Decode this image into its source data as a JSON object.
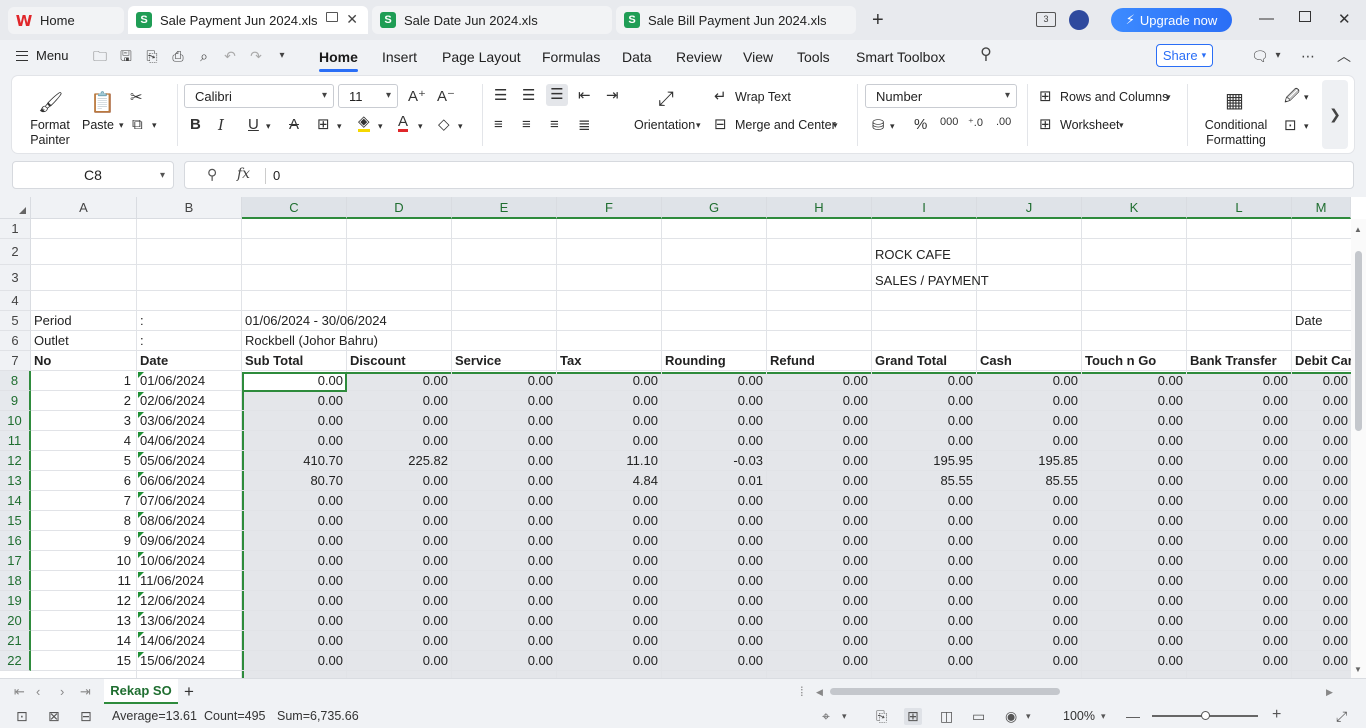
{
  "titlebar": {
    "home_tab": "Home",
    "tabs": [
      {
        "label": "Sale Payment Jun 2024.xls",
        "active": true
      },
      {
        "label": "Sale Date Jun 2024.xls",
        "active": false
      },
      {
        "label": "Sale Bill Payment Jun 2024.xls",
        "active": false
      }
    ],
    "panel_badge": "3",
    "upgrade": "Upgrade now"
  },
  "menubar": {
    "menu": "Menu",
    "tabs": [
      "Home",
      "Insert",
      "Page Layout",
      "Formulas",
      "Data",
      "Review",
      "View",
      "Tools",
      "Smart Toolbox"
    ],
    "share": "Share"
  },
  "ribbon": {
    "format_painter": "Format Painter",
    "paste": "Paste",
    "font_name": "Calibri",
    "font_size": "11",
    "wrap_text": "Wrap Text",
    "orientation": "Orientation",
    "merge_center": "Merge and Center",
    "number_format": "Number",
    "rows_columns": "Rows and Columns",
    "worksheet": "Worksheet",
    "conditional_formatting": "Conditional Formatting"
  },
  "formula_bar": {
    "name_box": "C8",
    "fx": "fx",
    "value": "0"
  },
  "columns": [
    "A",
    "B",
    "C",
    "D",
    "E",
    "F",
    "G",
    "H",
    "I",
    "J",
    "K",
    "L",
    "M"
  ],
  "row_numbers": [
    "1",
    "2",
    "3",
    "4",
    "5",
    "6",
    "7",
    "8",
    "9",
    "10",
    "11",
    "12",
    "13",
    "14",
    "15",
    "16",
    "17",
    "18",
    "19",
    "20",
    "21",
    "22"
  ],
  "sheet_text": {
    "company": "ROCK CAFE",
    "report": "SALES / PAYMENT",
    "period_label": "Period",
    "period_colon": ":",
    "period_value": "01/06/2024 - 30/06/2024",
    "date_label": "Date",
    "outlet_label": "Outlet",
    "outlet_colon": ":",
    "outlet_value": "Rockbell (Johor Bahru)"
  },
  "table_headers": [
    "No",
    "Date",
    "Sub Total",
    "Discount",
    "Service",
    "Tax",
    "Rounding",
    "Refund",
    "Grand Total",
    "Cash",
    "Touch n Go",
    "Bank Transfer",
    "Debit Car"
  ],
  "table_rows": [
    [
      "1",
      "01/06/2024",
      "0.00",
      "0.00",
      "0.00",
      "0.00",
      "0.00",
      "0.00",
      "0.00",
      "0.00",
      "0.00",
      "0.00",
      "0.00"
    ],
    [
      "2",
      "02/06/2024",
      "0.00",
      "0.00",
      "0.00",
      "0.00",
      "0.00",
      "0.00",
      "0.00",
      "0.00",
      "0.00",
      "0.00",
      "0.00"
    ],
    [
      "3",
      "03/06/2024",
      "0.00",
      "0.00",
      "0.00",
      "0.00",
      "0.00",
      "0.00",
      "0.00",
      "0.00",
      "0.00",
      "0.00",
      "0.00"
    ],
    [
      "4",
      "04/06/2024",
      "0.00",
      "0.00",
      "0.00",
      "0.00",
      "0.00",
      "0.00",
      "0.00",
      "0.00",
      "0.00",
      "0.00",
      "0.00"
    ],
    [
      "5",
      "05/06/2024",
      "410.70",
      "225.82",
      "0.00",
      "11.10",
      "-0.03",
      "0.00",
      "195.95",
      "195.85",
      "0.00",
      "0.00",
      "0.00"
    ],
    [
      "6",
      "06/06/2024",
      "80.70",
      "0.00",
      "0.00",
      "4.84",
      "0.01",
      "0.00",
      "85.55",
      "85.55",
      "0.00",
      "0.00",
      "0.00"
    ],
    [
      "7",
      "07/06/2024",
      "0.00",
      "0.00",
      "0.00",
      "0.00",
      "0.00",
      "0.00",
      "0.00",
      "0.00",
      "0.00",
      "0.00",
      "0.00"
    ],
    [
      "8",
      "08/06/2024",
      "0.00",
      "0.00",
      "0.00",
      "0.00",
      "0.00",
      "0.00",
      "0.00",
      "0.00",
      "0.00",
      "0.00",
      "0.00"
    ],
    [
      "9",
      "09/06/2024",
      "0.00",
      "0.00",
      "0.00",
      "0.00",
      "0.00",
      "0.00",
      "0.00",
      "0.00",
      "0.00",
      "0.00",
      "0.00"
    ],
    [
      "10",
      "10/06/2024",
      "0.00",
      "0.00",
      "0.00",
      "0.00",
      "0.00",
      "0.00",
      "0.00",
      "0.00",
      "0.00",
      "0.00",
      "0.00"
    ],
    [
      "11",
      "11/06/2024",
      "0.00",
      "0.00",
      "0.00",
      "0.00",
      "0.00",
      "0.00",
      "0.00",
      "0.00",
      "0.00",
      "0.00",
      "0.00"
    ],
    [
      "12",
      "12/06/2024",
      "0.00",
      "0.00",
      "0.00",
      "0.00",
      "0.00",
      "0.00",
      "0.00",
      "0.00",
      "0.00",
      "0.00",
      "0.00"
    ],
    [
      "13",
      "13/06/2024",
      "0.00",
      "0.00",
      "0.00",
      "0.00",
      "0.00",
      "0.00",
      "0.00",
      "0.00",
      "0.00",
      "0.00",
      "0.00"
    ],
    [
      "14",
      "14/06/2024",
      "0.00",
      "0.00",
      "0.00",
      "0.00",
      "0.00",
      "0.00",
      "0.00",
      "0.00",
      "0.00",
      "0.00",
      "0.00"
    ],
    [
      "15",
      "15/06/2024",
      "0.00",
      "0.00",
      "0.00",
      "0.00",
      "0.00",
      "0.00",
      "0.00",
      "0.00",
      "0.00",
      "0.00",
      "0.00"
    ]
  ],
  "sheet_tabs": [
    "Rekap SO"
  ],
  "statusbar": {
    "average": "Average=13.61",
    "count": "Count=495",
    "sum": "Sum=6,735.66",
    "zoom": "100%"
  },
  "colors": {
    "accent_blue": "#2a6ef6",
    "selection_green": "#2e8b3c",
    "wps_red": "#e0262a"
  }
}
